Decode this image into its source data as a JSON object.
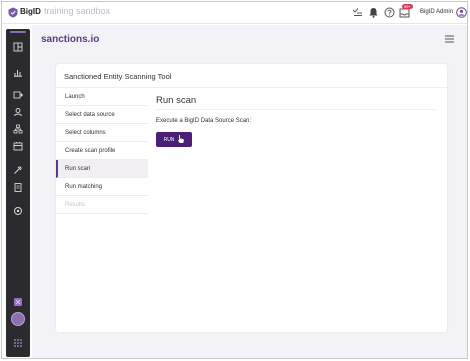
{
  "topbar": {
    "brand": "BigID",
    "environment": "training sandbox",
    "badge": "99+",
    "user_name": "BigID Admin",
    "icons": [
      "bigid-logo-icon",
      "tasks-icon",
      "bell-icon",
      "help-icon",
      "notifications-icon",
      "user-avatar-icon"
    ]
  },
  "sidebar": {
    "icons": [
      "dashboard-icon",
      "reports-icon",
      "data-sources-icon",
      "identities-icon",
      "hierarchy-icon",
      "catalog-icon",
      "remediation-icon",
      "clipboard-icon",
      "settings-icon",
      "apps-icon",
      "app-avatar-icon",
      "grid-menu-icon"
    ]
  },
  "main": {
    "app_title": "sanctions.io",
    "card_title": "Sanctioned Entity Scanning Tool",
    "steps": [
      {
        "label": "Launch",
        "state": "normal"
      },
      {
        "label": "Select data source",
        "state": "normal"
      },
      {
        "label": "Select columns",
        "state": "normal"
      },
      {
        "label": "Create scan profile",
        "state": "normal"
      },
      {
        "label": "Run scan",
        "state": "active"
      },
      {
        "label": "Run matching",
        "state": "normal"
      },
      {
        "label": "Results",
        "state": "disabled"
      }
    ],
    "content_title": "Run scan",
    "content_label": "Execute a BigID Data Source Scan:",
    "run_button": "RUN"
  },
  "colors": {
    "accent": "#5b3a86",
    "button": "#4a1f7a",
    "sidebar": "#2b2b2f",
    "background": "#f3f2f6",
    "badge": "#d63b57"
  }
}
